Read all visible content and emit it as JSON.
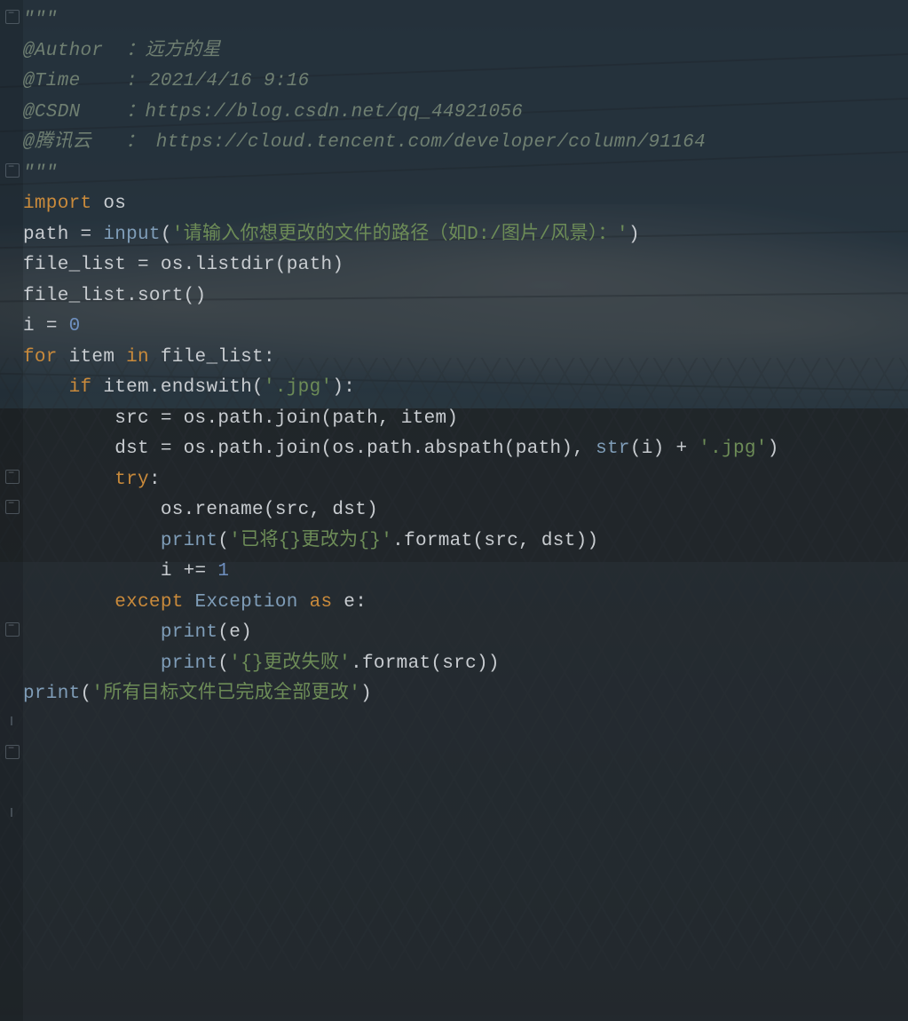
{
  "code": {
    "lines": [
      {
        "indent": 0,
        "tokens": [
          {
            "t": "\"\"\"",
            "c": "c-comment"
          }
        ]
      },
      {
        "indent": 0,
        "tokens": [
          {
            "t": "@Author  ：远方的星",
            "c": "c-comment"
          }
        ]
      },
      {
        "indent": 0,
        "tokens": [
          {
            "t": "@Time    : 2021/4/16 9:16",
            "c": "c-comment"
          }
        ]
      },
      {
        "indent": 0,
        "tokens": [
          {
            "t": "@CSDN    ：https://blog.csdn.net/qq_44921056",
            "c": "c-comment"
          }
        ]
      },
      {
        "indent": 0,
        "tokens": [
          {
            "t": "@腾讯云   ： https://cloud.tencent.com/developer/column/91164",
            "c": "c-comment"
          }
        ]
      },
      {
        "indent": 0,
        "tokens": [
          {
            "t": "\"\"\"",
            "c": "c-comment"
          }
        ]
      },
      {
        "indent": 0,
        "tokens": [
          {
            "t": "import ",
            "c": "c-kw"
          },
          {
            "t": "os",
            "c": "c-ident"
          }
        ]
      },
      {
        "indent": 0,
        "tokens": []
      },
      {
        "indent": 0,
        "tokens": []
      },
      {
        "indent": 0,
        "tokens": [
          {
            "t": "path ",
            "c": "c-ident"
          },
          {
            "t": "= ",
            "c": "c-punc"
          },
          {
            "t": "input",
            "c": "c-builtin"
          },
          {
            "t": "(",
            "c": "c-punc"
          },
          {
            "t": "'请输入你想更改的文件的路径（如D:/图片/风景）：'",
            "c": "c-str"
          },
          {
            "t": ")",
            "c": "c-punc"
          }
        ]
      },
      {
        "indent": 0,
        "tokens": [
          {
            "t": "file_list ",
            "c": "c-ident"
          },
          {
            "t": "= ",
            "c": "c-punc"
          },
          {
            "t": "os.listdir(path)",
            "c": "c-ident"
          }
        ]
      },
      {
        "indent": 0,
        "tokens": [
          {
            "t": "file_list.sort()",
            "c": "c-ident"
          }
        ]
      },
      {
        "indent": 0,
        "tokens": []
      },
      {
        "indent": 0,
        "tokens": []
      },
      {
        "indent": 0,
        "tokens": [
          {
            "t": "i ",
            "c": "c-ident"
          },
          {
            "t": "= ",
            "c": "c-punc"
          },
          {
            "t": "0",
            "c": "c-num"
          }
        ]
      },
      {
        "indent": 0,
        "tokens": [
          {
            "t": "for ",
            "c": "c-kw"
          },
          {
            "t": "item ",
            "c": "c-ident"
          },
          {
            "t": "in ",
            "c": "c-kw"
          },
          {
            "t": "file_list:",
            "c": "c-ident"
          }
        ]
      },
      {
        "indent": 1,
        "tokens": [
          {
            "t": "if ",
            "c": "c-kw"
          },
          {
            "t": "item.endswith(",
            "c": "c-ident"
          },
          {
            "t": "'.jpg'",
            "c": "c-str"
          },
          {
            "t": "):",
            "c": "c-ident"
          }
        ]
      },
      {
        "indent": 2,
        "tokens": [
          {
            "t": "src ",
            "c": "c-ident"
          },
          {
            "t": "= ",
            "c": "c-punc"
          },
          {
            "t": "os.path.join(path, item)",
            "c": "c-ident"
          }
        ]
      },
      {
        "indent": 2,
        "tokens": [
          {
            "t": "dst ",
            "c": "c-ident"
          },
          {
            "t": "= ",
            "c": "c-punc"
          },
          {
            "t": "os.path.join(os.path.abspath(path), ",
            "c": "c-ident"
          },
          {
            "t": "str",
            "c": "c-builtin"
          },
          {
            "t": "(i) ",
            "c": "c-ident"
          },
          {
            "t": "+ ",
            "c": "c-punc"
          },
          {
            "t": "'.jpg'",
            "c": "c-str"
          },
          {
            "t": ")",
            "c": "c-ident"
          }
        ]
      },
      {
        "indent": 0,
        "tokens": []
      },
      {
        "indent": 2,
        "tokens": [
          {
            "t": "try",
            "c": "c-kw"
          },
          {
            "t": ":",
            "c": "c-ident"
          }
        ]
      },
      {
        "indent": 3,
        "tokens": [
          {
            "t": "os.rename(src, dst)",
            "c": "c-ident"
          }
        ]
      },
      {
        "indent": 3,
        "tokens": [
          {
            "t": "print",
            "c": "c-builtin"
          },
          {
            "t": "(",
            "c": "c-ident"
          },
          {
            "t": "'已将{}更改为{}'",
            "c": "c-str"
          },
          {
            "t": ".format(src, dst))",
            "c": "c-ident"
          }
        ]
      },
      {
        "indent": 3,
        "tokens": [
          {
            "t": "i ",
            "c": "c-ident"
          },
          {
            "t": "+= ",
            "c": "c-punc"
          },
          {
            "t": "1",
            "c": "c-num"
          }
        ]
      },
      {
        "indent": 2,
        "tokens": [
          {
            "t": "except ",
            "c": "c-kw"
          },
          {
            "t": "Exception ",
            "c": "c-builtin"
          },
          {
            "t": "as ",
            "c": "c-kw"
          },
          {
            "t": "e:",
            "c": "c-ident"
          }
        ]
      },
      {
        "indent": 3,
        "tokens": [
          {
            "t": "print",
            "c": "c-builtin"
          },
          {
            "t": "(e)",
            "c": "c-ident"
          }
        ]
      },
      {
        "indent": 3,
        "tokens": [
          {
            "t": "print",
            "c": "c-builtin"
          },
          {
            "t": "(",
            "c": "c-ident"
          },
          {
            "t": "'{}更改失败'",
            "c": "c-str"
          },
          {
            "t": ".format(src))",
            "c": "c-ident"
          }
        ]
      },
      {
        "indent": 0,
        "tokens": [
          {
            "t": "print",
            "c": "c-builtin"
          },
          {
            "t": "(",
            "c": "c-ident"
          },
          {
            "t": "'所有目标文件已完成全部更改'",
            "c": "c-str"
          },
          {
            "t": ")",
            "c": "c-ident"
          }
        ]
      }
    ]
  },
  "gutter": {
    "fold_lines": [
      1,
      6,
      16,
      17,
      21,
      25
    ],
    "mark_lines": [
      24,
      27
    ]
  }
}
